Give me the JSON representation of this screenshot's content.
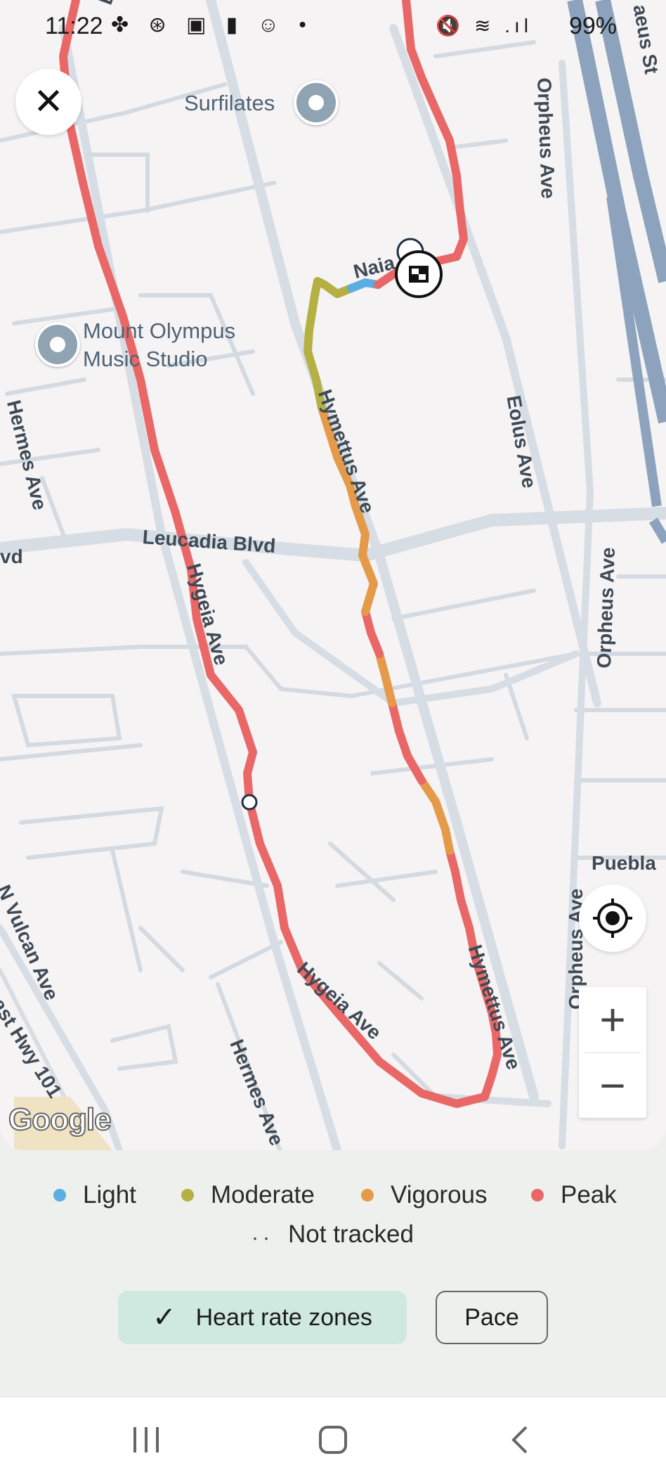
{
  "status_bar": {
    "time": "11:22",
    "battery": "99%"
  },
  "map": {
    "places": {
      "surfilates": "Surfilates",
      "music_studio_line1": "Mount Olympus",
      "music_studio_line2": "Music Studio"
    },
    "streets": {
      "orpheus_1": "Orpheus Ave",
      "orpheus_2": "Orpheus Ave",
      "orpheus_3": "Orpheus Ave",
      "eolus": "Eolus Ave",
      "hymettus_1": "Hymettus Ave",
      "hymettus_2": "Hymettus Ave",
      "hermes_1": "Hermes Ave",
      "hermes_2": "Hermes Ave",
      "leucadia": "Leucadia Blvd",
      "leucadia_left": "vd",
      "hygeia_1": "Hygeia Ave",
      "hygeia_2": "Hygeia Ave",
      "naia": "Naia",
      "puebla": "Puebla",
      "vulcan": "N Vulcan Ave",
      "coast_hwy": "oast Hwy 101",
      "top_right": "aeus St",
      "top_left": "E"
    },
    "attribution": "Google",
    "zoom_in": "+",
    "zoom_out": "−"
  },
  "legend": {
    "items": [
      {
        "label": "Light",
        "color": "#5aaee0"
      },
      {
        "label": "Moderate",
        "color": "#b5b043"
      },
      {
        "label": "Vigorous",
        "color": "#e59a4a"
      },
      {
        "label": "Peak",
        "color": "#ea6767"
      }
    ],
    "not_tracked": "Not tracked"
  },
  "toggles": {
    "heart_rate": "Heart rate zones",
    "pace": "Pace",
    "selected": "heart_rate"
  },
  "colors": {
    "peak": "#ea6767",
    "vigorous": "#e59a4a",
    "moderate": "#b5b043",
    "light": "#5aaee0",
    "highway": "#8da3bd",
    "road": "#d3dae1"
  }
}
